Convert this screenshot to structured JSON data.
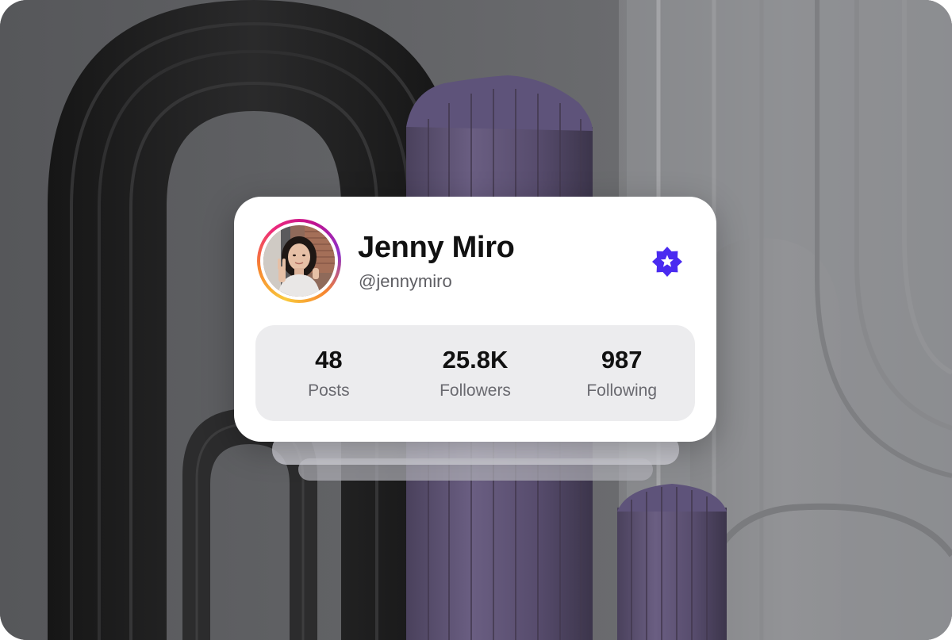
{
  "profile": {
    "name": "Jenny Miro",
    "handle": "@jennymiro",
    "verified": true,
    "avatar_icon": "avatar-photo",
    "badge_icon": "verified-badge-icon",
    "badge_color": "#4a2bf0"
  },
  "stats": [
    {
      "value": "48",
      "label": "Posts"
    },
    {
      "value": "25.8K",
      "label": "Followers"
    },
    {
      "value": "987",
      "label": "Following"
    }
  ],
  "colors": {
    "accent": "#4a2bf0",
    "card": "#ffffff",
    "stats_bg": "#ececee",
    "column_purple": "#5b5070"
  }
}
